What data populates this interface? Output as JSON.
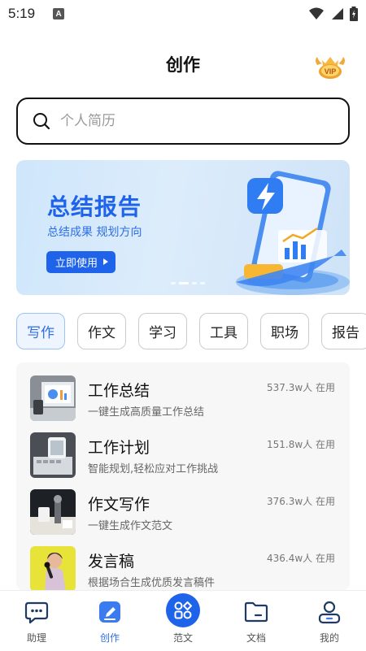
{
  "status_bar": {
    "time": "5:19",
    "notification_letter": "A"
  },
  "header": {
    "title": "创作",
    "vip_label": "VIP"
  },
  "search": {
    "placeholder": "个人简历"
  },
  "banner": {
    "title": "总结报告",
    "subtitle": "总结成果 规划方向",
    "button_label": "立即使用"
  },
  "tabs": [
    {
      "label": "写作",
      "active": true
    },
    {
      "label": "作文",
      "active": false
    },
    {
      "label": "学习",
      "active": false
    },
    {
      "label": "工具",
      "active": false
    },
    {
      "label": "职场",
      "active": false
    },
    {
      "label": "报告",
      "active": false
    }
  ],
  "list": [
    {
      "title": "工作总结",
      "desc": "一键生成高质量工作总结",
      "usage": "537.3w人 在用",
      "thumb_icon": "laptop-chart-icon"
    },
    {
      "title": "工作计划",
      "desc": "智能规划,轻松应对工作挑战",
      "usage": "151.8w人 在用",
      "thumb_icon": "keyboard-phone-icon"
    },
    {
      "title": "作文写作",
      "desc": "一键生成作文范文",
      "usage": "376.3w人 在用",
      "thumb_icon": "desk-writing-icon"
    },
    {
      "title": "发言稿",
      "desc": "根据场合生成优质发言稿件",
      "usage": "436.4w人 在用",
      "thumb_icon": "microphone-speaker-icon"
    }
  ],
  "bottom_nav": [
    {
      "label": "助理",
      "icon": "chat-bubble-icon",
      "active": false
    },
    {
      "label": "创作",
      "icon": "edit-pencil-icon",
      "active": true
    },
    {
      "label": "范文",
      "icon": "grid-apps-icon",
      "active": false
    },
    {
      "label": "文档",
      "icon": "folder-icon",
      "active": false
    },
    {
      "label": "我的",
      "icon": "person-icon",
      "active": false
    }
  ],
  "colors": {
    "accent": "#1e63e9",
    "active_text": "#2f6fe4",
    "banner_bg": "#d6e9fb"
  }
}
